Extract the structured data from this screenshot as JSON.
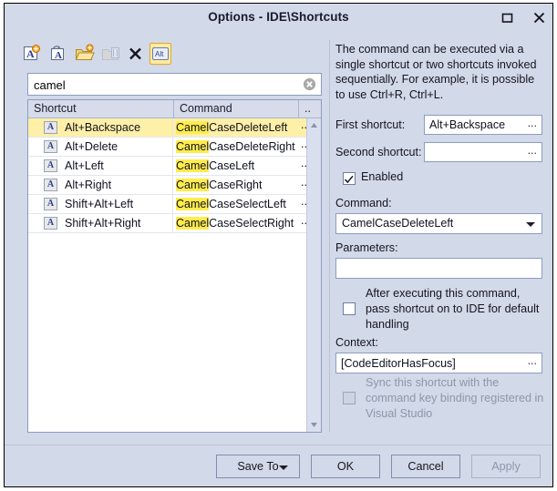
{
  "window": {
    "title": "Options - IDE\\Shortcuts",
    "maximize_icon": "maximize-icon",
    "close_icon": "close-icon"
  },
  "toolbar": {
    "items": [
      {
        "name": "add-shortcut-button",
        "icon": "new-shortcut-icon",
        "tooltip": "Add"
      },
      {
        "name": "duplicate-shortcut-button",
        "icon": "copy-shortcut-icon",
        "tooltip": "Duplicate"
      },
      {
        "name": "import-button",
        "icon": "open-folder-icon",
        "tooltip": "Import"
      },
      {
        "name": "export-button",
        "icon": "export-icon",
        "tooltip": "Export"
      },
      {
        "name": "delete-button",
        "icon": "delete-x-icon",
        "tooltip": "Delete"
      },
      {
        "name": "alt-toggle-button",
        "icon": "alt-key-icon",
        "label": "Alt"
      }
    ]
  },
  "search": {
    "value": "camel",
    "placeholder": "",
    "clear_icon": "clear-circle-icon"
  },
  "list": {
    "columns": [
      "Shortcut",
      "Command",
      ".."
    ],
    "rows": [
      {
        "icon": "A",
        "shortcut": "Alt+Backspace",
        "command_highlight": "Camel",
        "command_rest": "CaseDeleteLeft",
        "dots": "..",
        "selected": true
      },
      {
        "icon": "A",
        "shortcut": "Alt+Delete",
        "command_highlight": "Camel",
        "command_rest": "CaseDeleteRight",
        "dots": "..",
        "selected": false
      },
      {
        "icon": "A",
        "shortcut": "Alt+Left",
        "command_highlight": "Camel",
        "command_rest": "CaseLeft",
        "dots": "..",
        "selected": false
      },
      {
        "icon": "A",
        "shortcut": "Alt+Right",
        "command_highlight": "Camel",
        "command_rest": "CaseRight",
        "dots": "..",
        "selected": false
      },
      {
        "icon": "A",
        "shortcut": "Shift+Alt+Left",
        "command_highlight": "Camel",
        "command_rest": "CaseSelectLeft",
        "dots": "..",
        "selected": false
      },
      {
        "icon": "A",
        "shortcut": "Shift+Alt+Right",
        "command_highlight": "Camel",
        "command_rest": "CaseSelectRight",
        "dots": "..",
        "selected": false
      }
    ],
    "scrollbar": {
      "up_icon": "scroll-up-arrow-icon",
      "down_icon": "scroll-down-arrow-icon"
    }
  },
  "details": {
    "description": "The command can be executed via a single shortcut or two shortcuts invoked sequentially. For example, it is possible to use Ctrl+R, Ctrl+L.",
    "first_shortcut_label": "First shortcut:",
    "first_shortcut_value": "Alt+Backspace",
    "first_shortcut_ellipsis": "...",
    "second_shortcut_label": "Second shortcut:",
    "second_shortcut_value": "",
    "second_shortcut_ellipsis": "...",
    "enabled_label": "Enabled",
    "enabled_checked": true,
    "command_label": "Command:",
    "command_value": "CamelCaseDeleteLeft",
    "parameters_label": "Parameters:",
    "parameters_value": "",
    "pass_shortcut_label": "After executing this command, pass shortcut on to IDE for default handling",
    "pass_shortcut_checked": false,
    "context_label": "Context:",
    "context_value": "[CodeEditorHasFocus]",
    "context_ellipsis": "...",
    "sync_label": "Sync this shortcut with the command key binding registered in Visual Studio",
    "sync_checked": false,
    "sync_disabled": true
  },
  "footer": {
    "save_to_label": "Save To",
    "ok_label": "OK",
    "cancel_label": "Cancel",
    "apply_label": "Apply",
    "apply_disabled": true
  },
  "colors": {
    "dialog_background": "#d2d9e8",
    "field_background": "#ffffff",
    "field_border": "#8b9dc3",
    "selection_row": "#fff0a8",
    "search_highlight": "#ffec4d",
    "disabled_text": "#8e96ab",
    "accent_folder": "#f5c451"
  }
}
